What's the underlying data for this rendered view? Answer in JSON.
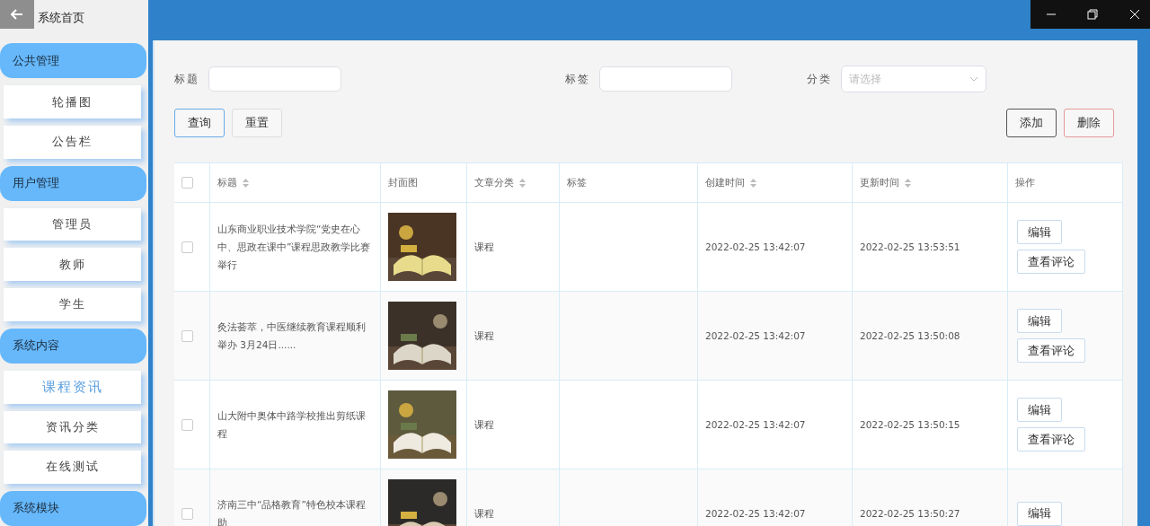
{
  "sidebar": {
    "home": "系统首页",
    "groups": [
      {
        "title": "公共管理",
        "items": [
          {
            "label": "轮播图",
            "selected": false
          },
          {
            "label": "公告栏",
            "selected": false
          }
        ]
      },
      {
        "title": "用户管理",
        "items": [
          {
            "label": "管理员",
            "selected": false
          },
          {
            "label": "教师",
            "selected": false
          },
          {
            "label": "学生",
            "selected": false
          }
        ]
      },
      {
        "title": "系统内容",
        "items": [
          {
            "label": "课程资讯",
            "selected": true
          },
          {
            "label": "资讯分类",
            "selected": false
          },
          {
            "label": "在线测试",
            "selected": false
          }
        ]
      },
      {
        "title": "系统模块"
      }
    ]
  },
  "search": {
    "fields": [
      {
        "kind": "text",
        "label": "标题"
      },
      {
        "kind": "text",
        "label": "标签"
      },
      {
        "kind": "select",
        "label": "分类",
        "placeholder": "请选择"
      }
    ],
    "left_buttons": [
      {
        "label": "查询",
        "kind": "primary"
      },
      {
        "label": "重置",
        "kind": "plain"
      }
    ],
    "right_buttons": [
      {
        "label": "添加",
        "kind": "dark"
      },
      {
        "label": "删除",
        "kind": "danger"
      }
    ]
  },
  "table": {
    "select_all_checked": false,
    "columns": [
      {
        "label": "标题",
        "sortable": true
      },
      {
        "label": "封面图",
        "sortable": false
      },
      {
        "label": "文章分类",
        "sortable": true
      },
      {
        "label": "标签",
        "sortable": false
      },
      {
        "label": "创建时间",
        "sortable": true
      },
      {
        "label": "更新时间",
        "sortable": true
      },
      {
        "label": "操作",
        "sortable": false
      }
    ],
    "rows": [
      {
        "checked": false,
        "title": "山东商业职业技术学院“党史在心中、思政在课中”课程思政教学比赛举行",
        "cover": {
          "kind": "picture"
        },
        "category": "课程",
        "created": "2022-02-25 13:42:07",
        "updated": "2022-02-25 13:53:51",
        "actions": [
          "编辑",
          "查看评论"
        ]
      },
      {
        "checked": false,
        "title": "灸法荟萃，中医继续教育课程顺利举办 3月24日......",
        "cover": {
          "kind": "picture"
        },
        "category": "课程",
        "created": "2022-02-25 13:42:07",
        "updated": "2022-02-25 13:50:08",
        "actions": [
          "编辑",
          "查看评论"
        ]
      },
      {
        "checked": false,
        "title": "山大附中奥体中路学校推出剪纸课程",
        "cover": {
          "kind": "picture"
        },
        "category": "课程",
        "created": "2022-02-25 13:42:07",
        "updated": "2022-02-25 13:50:15",
        "actions": [
          "编辑",
          "查看评论"
        ]
      },
      {
        "checked": false,
        "title": "济南三中“品格教育”特色校本课程助",
        "cover": {
          "kind": "picture"
        },
        "category": "课程",
        "created": "2022-02-25 13:42:07",
        "updated": "2022-02-25 13:50:27",
        "actions": [
          "编辑"
        ]
      }
    ]
  }
}
